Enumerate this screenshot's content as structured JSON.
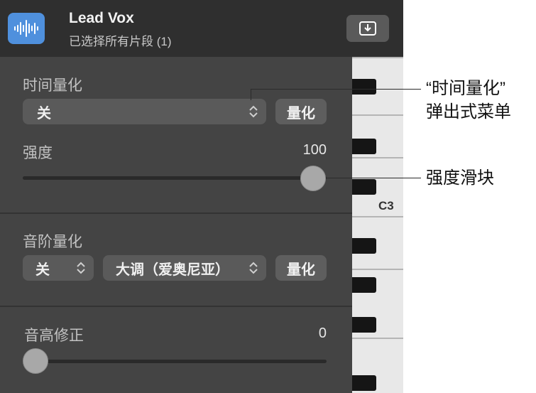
{
  "header": {
    "icon": "waveform-icon",
    "title": "Lead Vox",
    "subtitle": "已选择所有片段 (1)",
    "download_icon": "download-tray-icon"
  },
  "time_quantize": {
    "label": "时间量化",
    "popup_value": "关",
    "button_label": "量化"
  },
  "strength": {
    "label": "强度",
    "value": "100",
    "level": 1.0
  },
  "scale_quantize": {
    "label": "音阶量化",
    "mode_value": "关",
    "scale_value": "大调（爱奥尼亚）",
    "button_label": "量化"
  },
  "pitch_correction": {
    "label": "音高修正",
    "value": "0",
    "level": 0.0
  },
  "keyboard": {
    "c3_label": "C3"
  },
  "callouts": {
    "time_quantize_line1": "“时间量化”",
    "time_quantize_line2": "弹出式菜单",
    "strength_slider": "强度滑块"
  }
}
